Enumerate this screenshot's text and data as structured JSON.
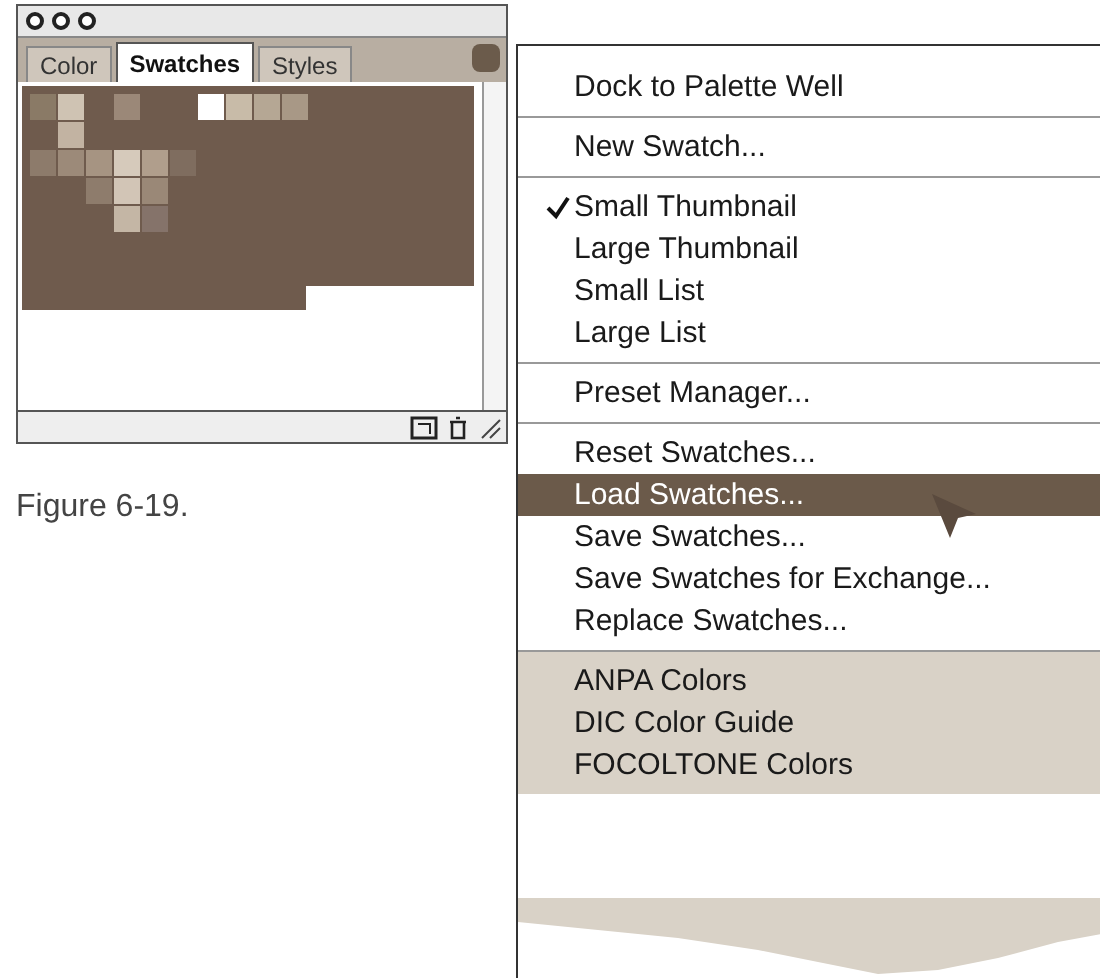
{
  "palette": {
    "tabs": [
      {
        "label": "Color",
        "selected": false
      },
      {
        "label": "Swatches",
        "selected": true
      },
      {
        "label": "Styles",
        "selected": false
      }
    ]
  },
  "caption": "Figure 6-19.",
  "menu": {
    "groups": [
      [
        {
          "label": "Dock to Palette Well",
          "checked": false,
          "selected": false
        }
      ],
      [
        {
          "label": "New Swatch...",
          "checked": false,
          "selected": false
        }
      ],
      [
        {
          "label": "Small Thumbnail",
          "checked": true,
          "selected": false
        },
        {
          "label": "Large Thumbnail",
          "checked": false,
          "selected": false
        },
        {
          "label": "Small List",
          "checked": false,
          "selected": false
        },
        {
          "label": "Large List",
          "checked": false,
          "selected": false
        }
      ],
      [
        {
          "label": "Preset Manager...",
          "checked": false,
          "selected": false
        }
      ],
      [
        {
          "label": "Reset Swatches...",
          "checked": false,
          "selected": false
        },
        {
          "label": "Load Swatches...",
          "checked": false,
          "selected": true
        },
        {
          "label": "Save Swatches...",
          "checked": false,
          "selected": false
        },
        {
          "label": "Save Swatches for Exchange...",
          "checked": false,
          "selected": false
        },
        {
          "label": "Replace Swatches...",
          "checked": false,
          "selected": false
        }
      ],
      [
        {
          "label": "ANPA Colors",
          "checked": false,
          "selected": false
        },
        {
          "label": "DIC Color Guide",
          "checked": false,
          "selected": false
        },
        {
          "label": "FOCOLTONE Colors",
          "checked": false,
          "selected": false
        }
      ]
    ]
  }
}
